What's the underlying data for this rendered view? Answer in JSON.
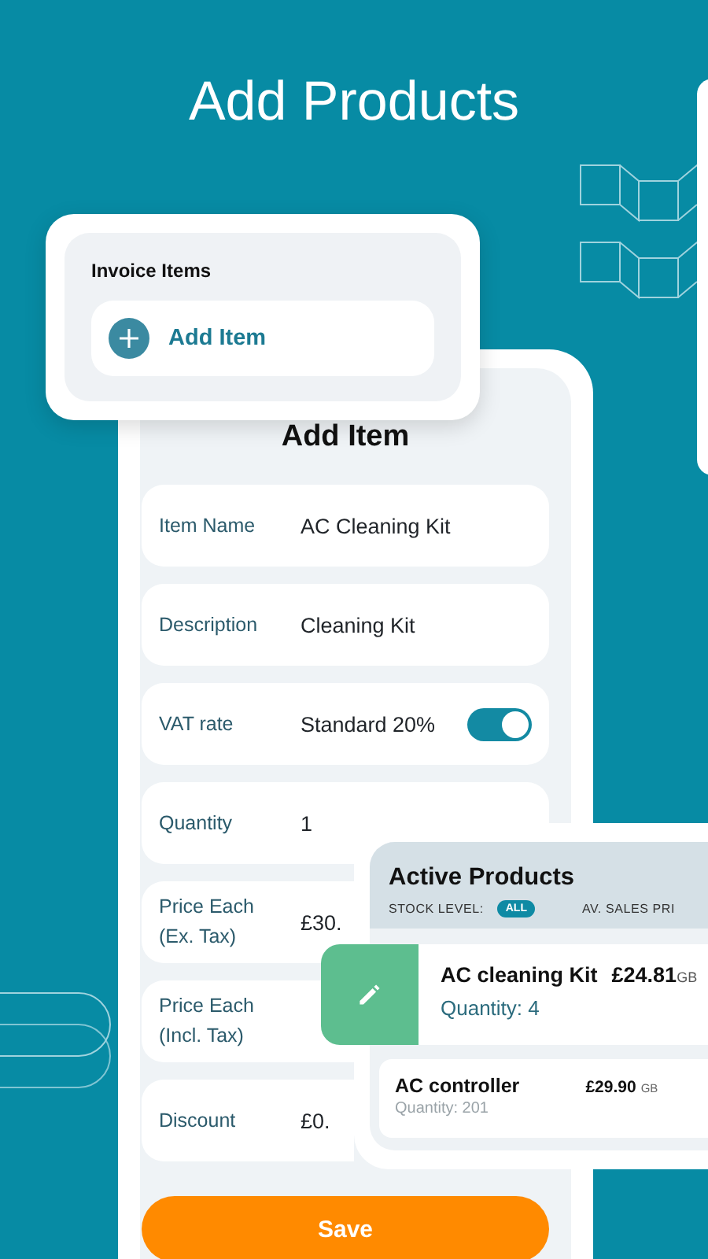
{
  "title": "Add Products",
  "invoice_card": {
    "heading": "Invoice Items",
    "add_button": "Add Item"
  },
  "form": {
    "title": "Add Item",
    "fields": [
      {
        "kind": "text",
        "label": "Item Name",
        "value": "AC Cleaning Kit"
      },
      {
        "kind": "text",
        "label": "Description",
        "value": "Cleaning Kit"
      },
      {
        "kind": "toggle",
        "label": "VAT rate",
        "value": "Standard 20%",
        "on": true
      },
      {
        "kind": "text",
        "label": "Quantity",
        "value": "1"
      },
      {
        "kind": "text",
        "label": "Price Each (Ex. Tax)",
        "value": "£30."
      },
      {
        "kind": "text",
        "label": "Price Each (Incl. Tax)"
      },
      {
        "kind": "text",
        "label": "Discount",
        "value": "£0."
      }
    ],
    "save_button": "Save"
  },
  "products": {
    "title": "Active Products",
    "stock_label": "STOCK LEVEL:",
    "filter": "ALL",
    "price_column": "AV. SALES PRI",
    "items": [
      {
        "name": "AC cleaning Kit",
        "price": "£24.81",
        "currency": "GB",
        "quantity": "Quantity: 4",
        "swiped": true
      },
      {
        "name": "AC controller",
        "price": "£29.90",
        "currency": "GB",
        "quantity": "Quantity: 201",
        "swiped": false
      }
    ]
  }
}
